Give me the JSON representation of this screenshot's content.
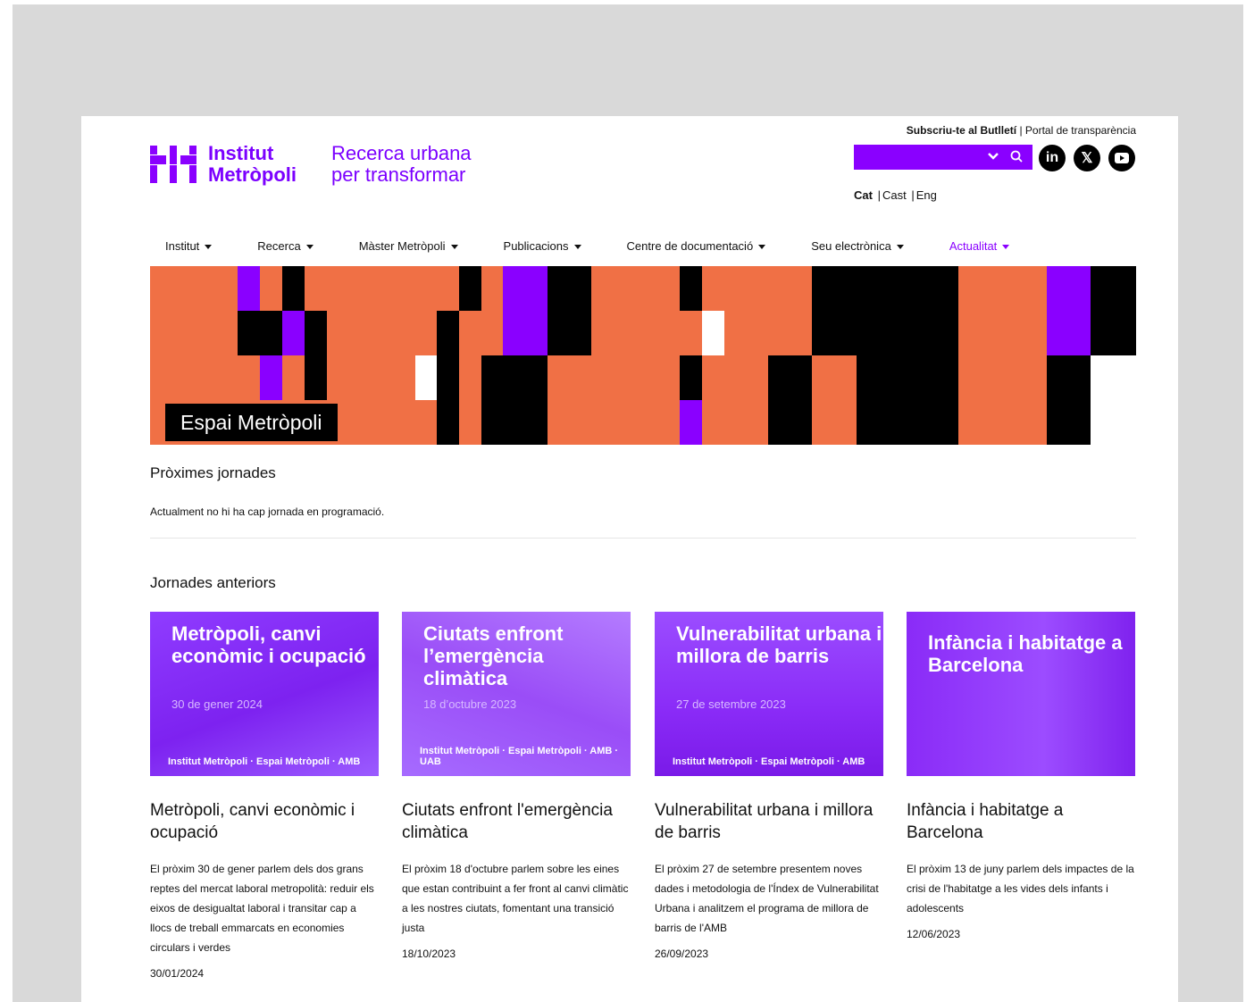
{
  "header": {
    "logo_line1": "Institut",
    "logo_line2": "Metròpoli",
    "tagline_line1": "Recerca urbana",
    "tagline_line2": "per transformar",
    "subscribe": "Subscriu-te al Butlletí",
    "separator": "|",
    "transparency": "Portal de transparència",
    "languages": [
      "Cat",
      "Cast",
      "Eng"
    ],
    "social": [
      "linkedin-icon",
      "x-icon",
      "youtube-icon"
    ],
    "accent_color": "#8a00ff"
  },
  "nav": {
    "items": [
      {
        "label": "Institut"
      },
      {
        "label": "Recerca"
      },
      {
        "label": "Màster Metròpoli"
      },
      {
        "label": "Publicacions"
      },
      {
        "label": "Centre de documentació"
      },
      {
        "label": "Seu electrònica"
      },
      {
        "label": "Actualitat"
      }
    ]
  },
  "banner": {
    "title": "Espai Metròpoli",
    "colors": {
      "orange": "#f07045",
      "purple": "#8a00ff",
      "black": "#000000",
      "white": "#ffffff"
    }
  },
  "upcoming": {
    "title": "Pròximes jornades",
    "message": "Actualment no hi ha cap jornada en programació."
  },
  "past": {
    "title": "Jornades anteriors",
    "cards": [
      {
        "img_title": "Metròpoli, canvi econòmic i ocupació",
        "img_date": "30 de gener 2024",
        "img_logos": "Institut Metròpoli · Espai Metròpoli · AMB",
        "title": "Metròpoli, canvi econòmic i ocupació",
        "desc": "El pròxim 30 de gener parlem dels dos grans reptes del mercat laboral metropolità: reduir els eixos de desigualtat laboral i transitar cap a llocs de treball emmarcats en economies circulars i verdes",
        "date": "30/01/2024"
      },
      {
        "img_title": "Ciutats enfront l’emergència climàtica",
        "img_date": "18 d’octubre 2023",
        "img_logos": "Institut Metròpoli · Espai Metròpoli · AMB · UAB",
        "title": "Ciutats enfront l'emergència climàtica",
        "desc": "El pròxim 18 d'octubre parlem sobre les eines que estan contribuint a fer front al canvi climàtic a les nostres ciutats, fomentant una transició justa",
        "date": "18/10/2023"
      },
      {
        "img_title": "Vulnerabilitat urbana i millora de barris",
        "img_date": "27 de setembre 2023",
        "img_logos": "Institut Metròpoli · Espai Metròpoli · AMB",
        "title": "Vulnerabilitat urbana i millora de barris",
        "desc": "El pròxim 27 de setembre presentem noves dades i metodologia de l'Índex de Vulnerabilitat Urbana i analitzem el programa de millora de barris de l'AMB",
        "date": "26/09/2023"
      },
      {
        "img_title": "Infància i habitatge a Barcelona",
        "img_date": "",
        "img_logos": "",
        "title": "Infància i habitatge a Barcelona",
        "desc": "El pròxim 13 de juny parlem dels impactes de la crisi de l'habitatge a les vides dels infants i adolescents",
        "date": "12/06/2023"
      }
    ]
  }
}
